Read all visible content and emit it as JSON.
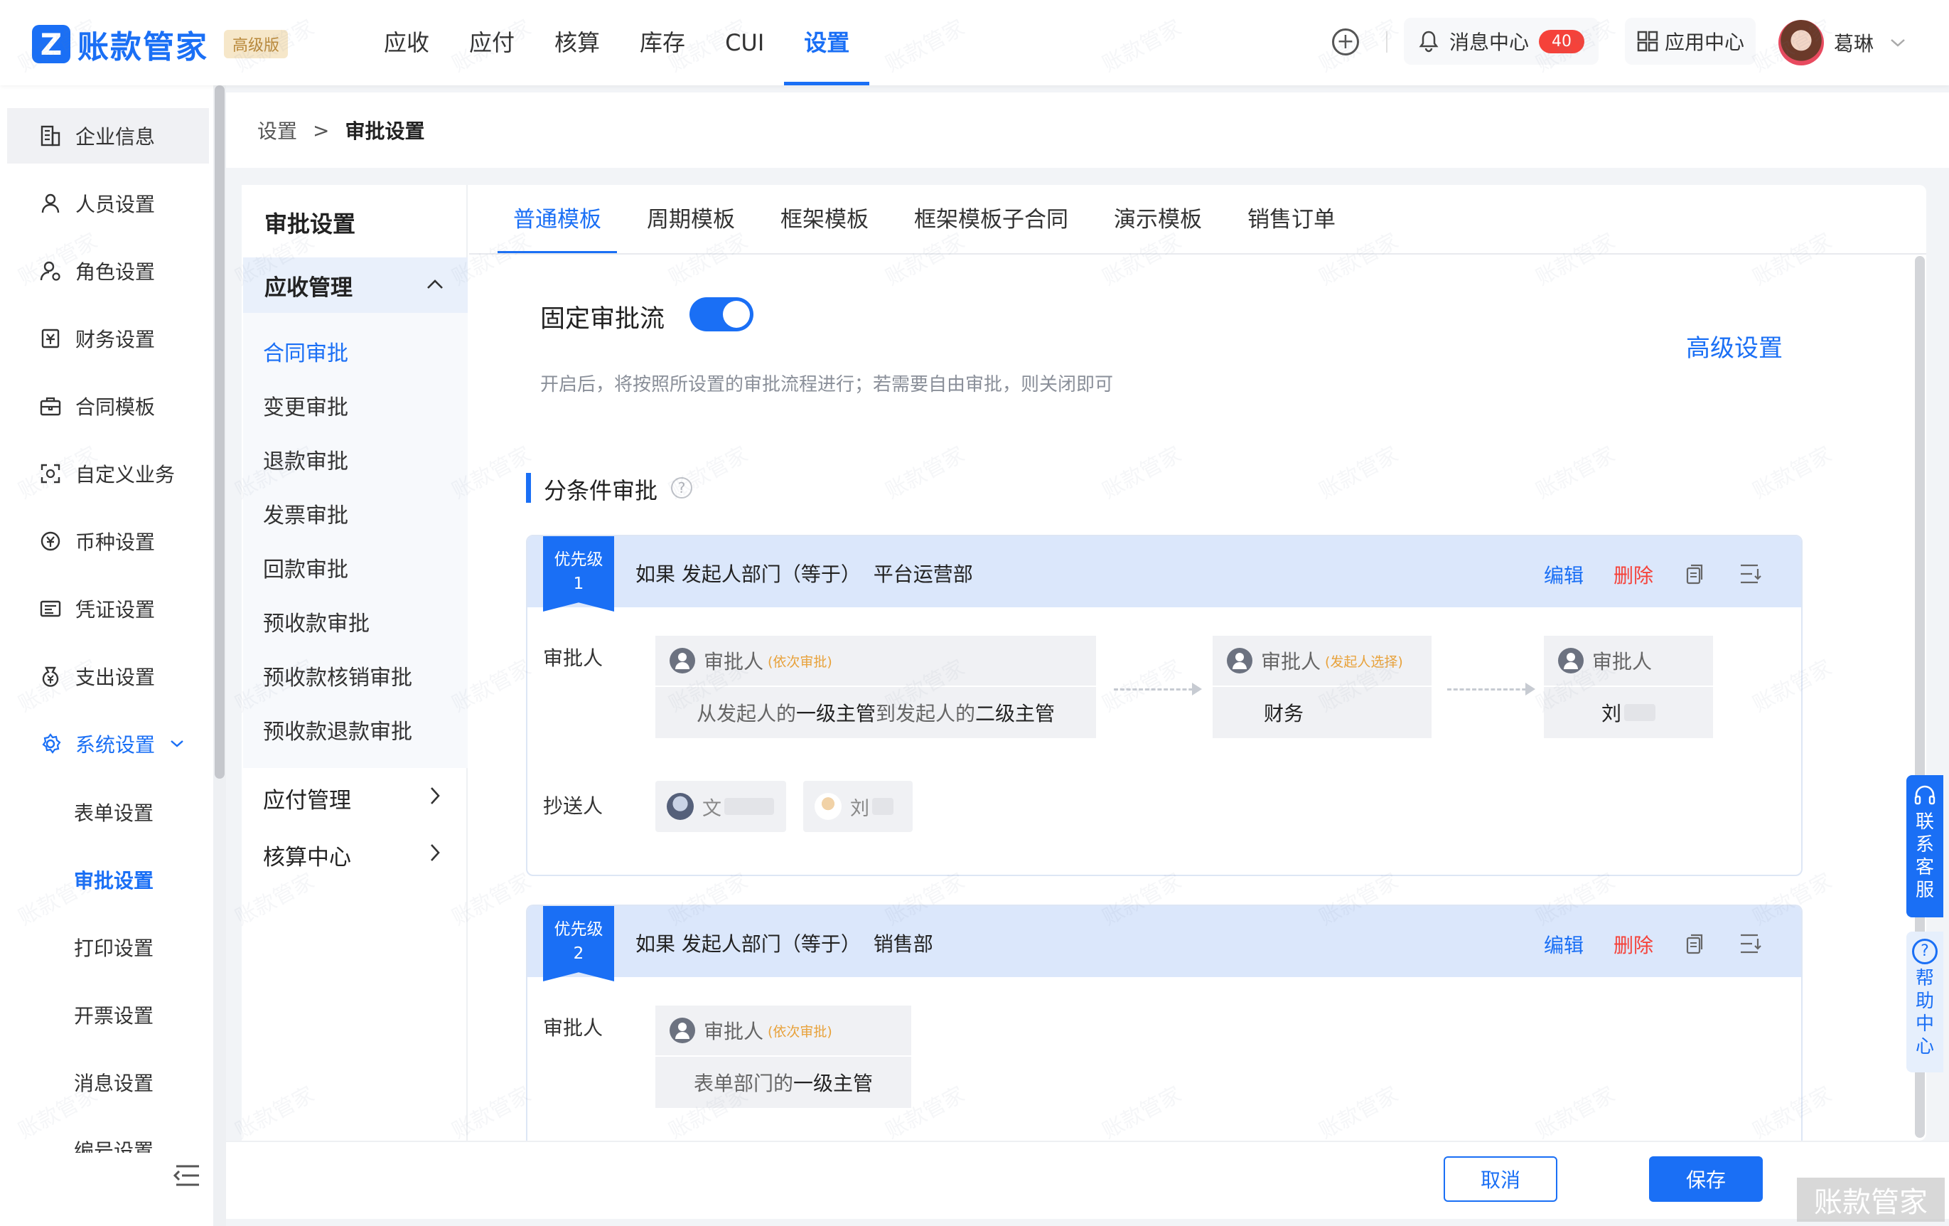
{
  "brand": {
    "logo_glyph": "Z",
    "name": "账款管家",
    "edition": "高级版"
  },
  "topnav": [
    {
      "label": "应收",
      "active": false
    },
    {
      "label": "应付",
      "active": false
    },
    {
      "label": "核算",
      "active": false
    },
    {
      "label": "库存",
      "active": false
    },
    {
      "label": "CUI",
      "active": false
    },
    {
      "label": "设置",
      "active": true
    }
  ],
  "header": {
    "plus_glyph": "+",
    "msg_center": "消息中心",
    "msg_count": "40",
    "app_center": "应用中心",
    "user_name": "葛琳"
  },
  "sidebar": {
    "items": [
      {
        "label": "企业信息",
        "icon": "building-icon"
      },
      {
        "label": "人员设置",
        "icon": "user-icon"
      },
      {
        "label": "角色设置",
        "icon": "role-icon"
      },
      {
        "label": "财务设置",
        "icon": "finance-icon"
      },
      {
        "label": "合同模板",
        "icon": "briefcase-icon"
      },
      {
        "label": "自定义业务",
        "icon": "custom-icon"
      },
      {
        "label": "币种设置",
        "icon": "currency-icon"
      },
      {
        "label": "凭证设置",
        "icon": "voucher-icon"
      },
      {
        "label": "支出设置",
        "icon": "expense-icon"
      },
      {
        "label": "系统设置",
        "icon": "gear-icon"
      }
    ],
    "sub_items": [
      "表单设置",
      "审批设置",
      "打印设置",
      "开票设置",
      "消息设置",
      "编号设置"
    ]
  },
  "breadcrumb": {
    "root": "设置",
    "sep": ">",
    "current": "审批设置"
  },
  "inner_nav": {
    "title": "审批设置",
    "open_group": "应收管理",
    "links": [
      "合同审批",
      "变更审批",
      "退款审批",
      "发票审批",
      "回款审批",
      "预收款审批",
      "预收款核销审批",
      "预收款退款审批"
    ],
    "closed_groups": [
      "应付管理",
      "核算中心"
    ]
  },
  "tabs": [
    "普通模板",
    "周期模板",
    "框架模板",
    "框架模板子合同",
    "演示模板",
    "销售订单"
  ],
  "settings": {
    "fixed_flow_label": "固定审批流",
    "fixed_flow_on": true,
    "advanced_link": "高级设置",
    "hint": "开启后，将按照所设置的审批流程进行；若需要自由审批，则关闭即可",
    "section_title": "分条件审批",
    "help_glyph": "?"
  },
  "rules": [
    {
      "priority_label": "优先级",
      "priority": "1",
      "condition": "如果 发起人部门（等于）  平台运营部",
      "edit": "编辑",
      "delete": "删除",
      "approver_label": "审批人",
      "cc_label": "抄送人",
      "nodes": [
        {
          "title": "审批人",
          "tag": "(依次审批)",
          "body_pre": "从发起人的 ",
          "body_b1": "一级主管",
          "body_mid": " 到发起人的 ",
          "body_b2": "二级主管"
        },
        {
          "title": "审批人",
          "tag": "(发起人选择)",
          "body_pre": "",
          "body_b1": "财务",
          "body_mid": "",
          "body_b2": ""
        },
        {
          "title": "审批人",
          "tag": "",
          "body_pre": "",
          "body_b1": "刘",
          "body_mid": "",
          "body_b2": ""
        }
      ],
      "cc": [
        {
          "name": "文"
        },
        {
          "name": "刘"
        }
      ]
    },
    {
      "priority_label": "优先级",
      "priority": "2",
      "condition": "如果 发起人部门（等于）  销售部",
      "edit": "编辑",
      "delete": "删除",
      "approver_label": "审批人",
      "nodes": [
        {
          "title": "审批人",
          "tag": "(依次审批)",
          "body_pre": "表单部门的 ",
          "body_b1": "一级主管",
          "body_mid": "",
          "body_b2": ""
        }
      ]
    }
  ],
  "footer": {
    "cancel": "取消",
    "save": "保存"
  },
  "float": {
    "contact": [
      "联",
      "系",
      "客",
      "服"
    ],
    "help": [
      "帮",
      "助",
      "中",
      "心"
    ],
    "help_glyph": "?"
  },
  "watermark": "账款管家",
  "colors": {
    "primary": "#1a6ff5",
    "danger": "#f5423a",
    "tag": "#e8a23b",
    "badge": "#f5423a"
  }
}
